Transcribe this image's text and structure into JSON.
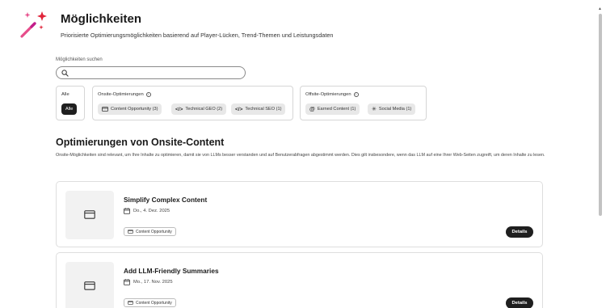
{
  "header": {
    "title": "Möglichkeiten",
    "subtitle": "Priorisierte Optimierungsmöglichkeiten basierend auf Player-Lücken, Trend-Themen und Leistungsdaten",
    "icon": "magic-wand-icon"
  },
  "search": {
    "label": "Möglichkeiten suchen",
    "value": "",
    "placeholder": ""
  },
  "filters": {
    "all": {
      "label": "Alle",
      "button": "Alle"
    },
    "onsite": {
      "label": "Onsite-Optimierungen",
      "chips": [
        {
          "label": "Content Opportunity (3)",
          "icon": "card-icon"
        },
        {
          "label": "Technical GEO (2)",
          "icon": "code-icon"
        },
        {
          "label": "Technical SEO (1)",
          "icon": "code-icon"
        }
      ]
    },
    "offsite": {
      "label": "Offsite-Optimierungen",
      "chips": [
        {
          "label": "Earned Content (1)",
          "icon": "at-icon"
        },
        {
          "label": "Social Media (1)",
          "icon": "sparkle-icon"
        }
      ]
    }
  },
  "section": {
    "title": "Optimierungen von Onsite-Content",
    "description": "Onsite-Möglichkeiten sind relevant, um Ihre Inhalte zu optimieren, damit sie von LLMs besser verstanden und auf Benutzerabfragen abgestimmt werden. Dies gilt insbesondere, wenn das LLM auf eine Ihrer Web-Seiten zugreift, um deren Inhalte zu lesen."
  },
  "cards": [
    {
      "title": "Simplify Complex Content",
      "date": "Do., 4. Dez. 2025",
      "tag": "Content Opportunity",
      "button": "Details"
    },
    {
      "title": "Add LLM-Friendly Summaries",
      "date": "Mo., 17. Nov. 2025",
      "tag": "Content Opportunity",
      "button": "Details"
    }
  ],
  "colors": {
    "accent": "#1f1f1f",
    "chip_bg": "#e8e8e8",
    "wand_star_red": "#e0243a",
    "wand_star_pink": "#e64c8a"
  }
}
